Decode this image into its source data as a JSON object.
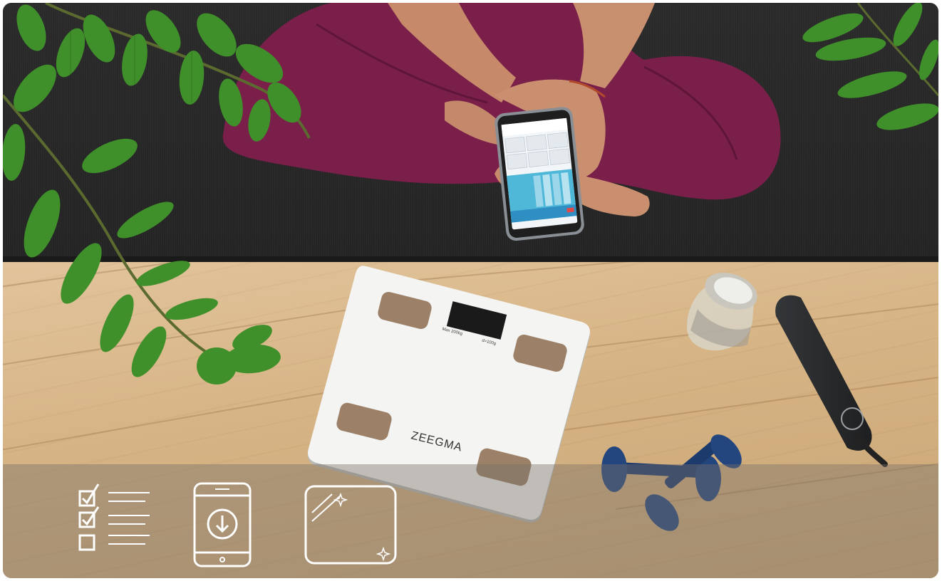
{
  "scale": {
    "brand": "ZEEGMA",
    "max_label": "Max 200kg",
    "increment_label": "d=100g"
  },
  "overlay_icons": [
    "checklist-icon",
    "app-download-icon",
    "tempered-glass-icon"
  ],
  "colors": {
    "overlay": "#786f68",
    "mat": "#262626",
    "floor": "#d8b486",
    "leggings": "#7a1f4a",
    "leaf": "#3f8f2a",
    "scale": "#f4f4f2",
    "dumbbell": "#1f3f75"
  }
}
